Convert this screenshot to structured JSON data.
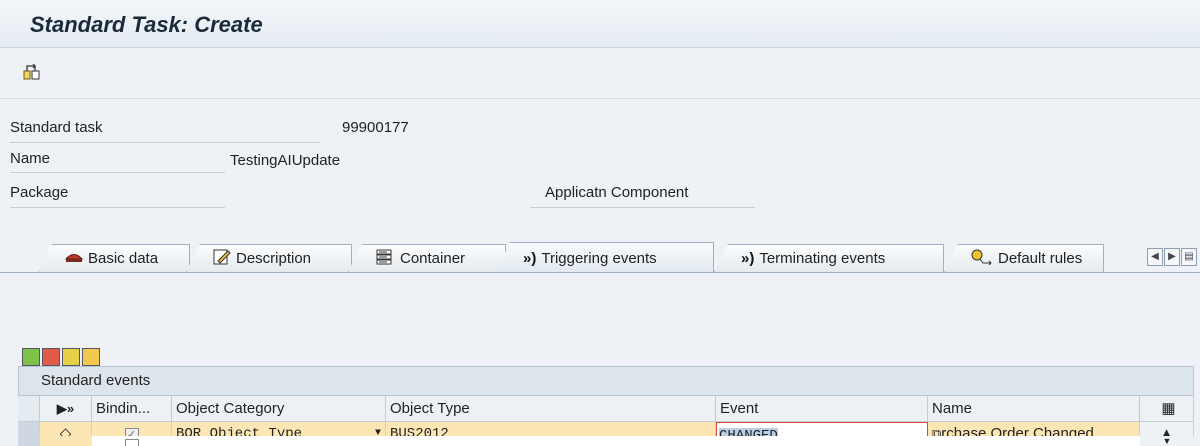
{
  "window": {
    "title": "Standard Task: Create"
  },
  "toolbar": {
    "icon": "other-object-icon"
  },
  "form": {
    "standard_task_label": "Standard task",
    "standard_task_value": "99900177",
    "name_label": "Name",
    "name_value": "TestingAIUpdate",
    "package_label": "Package",
    "appl_component_label": "Applicatn Component"
  },
  "tabs": [
    {
      "label": "Basic data",
      "icon": "basic-data-icon"
    },
    {
      "label": "Description",
      "icon": "description-icon"
    },
    {
      "label": "Container",
      "icon": "container-icon"
    },
    {
      "label": "Triggering events",
      "icon": "events-icon"
    },
    {
      "label": "Terminating events",
      "icon": "events-icon"
    },
    {
      "label": "Default rules",
      "icon": "rules-icon"
    }
  ],
  "grid": {
    "title": "Standard events",
    "columns": [
      "Bindin...",
      "Object Category",
      "Object Type",
      "Event",
      "Name"
    ],
    "rows": [
      {
        "binding_checked": true,
        "object_category": "BOR Object Type",
        "object_type": "BUS2012",
        "event": "CHANGED",
        "name": "rchase Order Changed"
      },
      {
        "binding_checked": false,
        "object_category": "",
        "object_type": "",
        "event": "",
        "name": ""
      }
    ]
  },
  "colors": {
    "row_highlight": "#fbe6b4",
    "selected_cell": "#b9cfe6",
    "title_bg": "#e4ebf2"
  }
}
